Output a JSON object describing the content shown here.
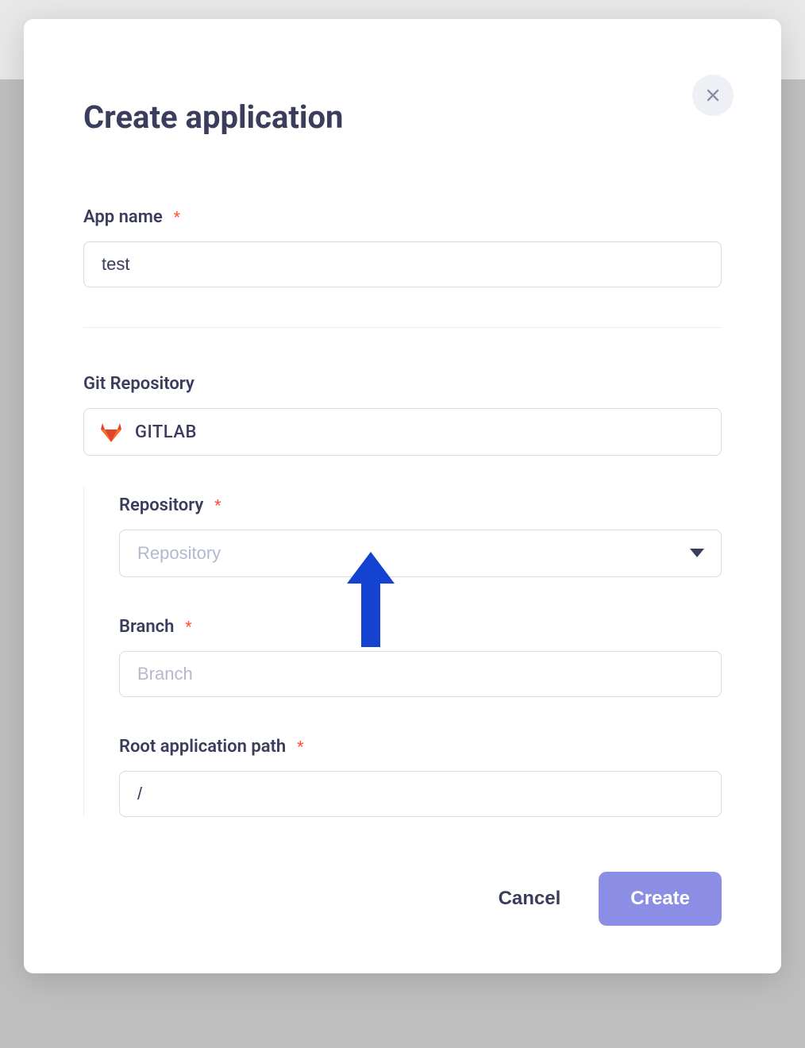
{
  "modal": {
    "title": "Create application",
    "fields": {
      "app_name": {
        "label": "App name",
        "value": "test",
        "required": true
      },
      "git_repository": {
        "label": "Git Repository",
        "provider": "GITLAB"
      },
      "repository": {
        "label": "Repository",
        "placeholder": "Repository",
        "required": true
      },
      "branch": {
        "label": "Branch",
        "placeholder": "Branch",
        "required": true
      },
      "root_path": {
        "label": "Root application path",
        "value": "/",
        "required": true
      }
    },
    "buttons": {
      "cancel": "Cancel",
      "create": "Create"
    },
    "required_marker": "*"
  }
}
